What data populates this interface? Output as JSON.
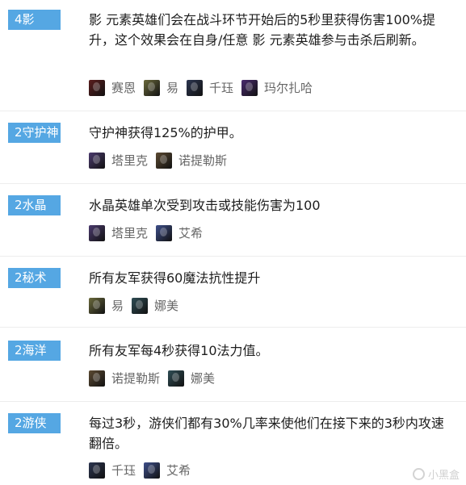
{
  "entries": [
    {
      "tag": "4影",
      "description": "影 元素英雄们会在战斗环节开始后的5秒里获得伤害100%提升，这个效果会在自身/任意 影 元素英雄参与击杀后刷新。",
      "heroes": [
        {
          "name": "赛恩",
          "color": "#5a1e1e"
        },
        {
          "name": "易",
          "color": "#6b6a3c"
        },
        {
          "name": "千珏",
          "color": "#2c3550"
        },
        {
          "name": "玛尔扎哈",
          "color": "#4a2a6e"
        }
      ]
    },
    {
      "tag": "2守护神",
      "description": "守护神获得125%的护甲。",
      "heroes": [
        {
          "name": "塔里克",
          "color": "#4b3a6e"
        },
        {
          "name": "诺提勒斯",
          "color": "#5c4a32"
        }
      ]
    },
    {
      "tag": "2水晶",
      "description": "水晶英雄单次受到攻击或技能伤害为100",
      "heroes": [
        {
          "name": "塔里克",
          "color": "#4b3a6e"
        },
        {
          "name": "艾希",
          "color": "#3e4f8a"
        }
      ]
    },
    {
      "tag": "2秘术",
      "description": "所有友军获得60魔法抗性提升",
      "heroes": [
        {
          "name": "易",
          "color": "#6b6a3c"
        },
        {
          "name": "娜美",
          "color": "#2f4d55"
        }
      ]
    },
    {
      "tag": "2海洋",
      "description": "所有友军每4秒获得10法力值。",
      "heroes": [
        {
          "name": "诺提勒斯",
          "color": "#5c4a32"
        },
        {
          "name": "娜美",
          "color": "#2f4d55"
        }
      ]
    },
    {
      "tag": "2游侠",
      "description": "每过3秒，游侠们都有30%几率来使他们在接下来的3秒内攻速翻倍。",
      "heroes": [
        {
          "name": "千珏",
          "color": "#2c3550"
        },
        {
          "name": "艾希",
          "color": "#3e4f8a"
        }
      ]
    }
  ],
  "watermark": {
    "text": "小黑盒"
  },
  "accent_color": "#55a7e3"
}
